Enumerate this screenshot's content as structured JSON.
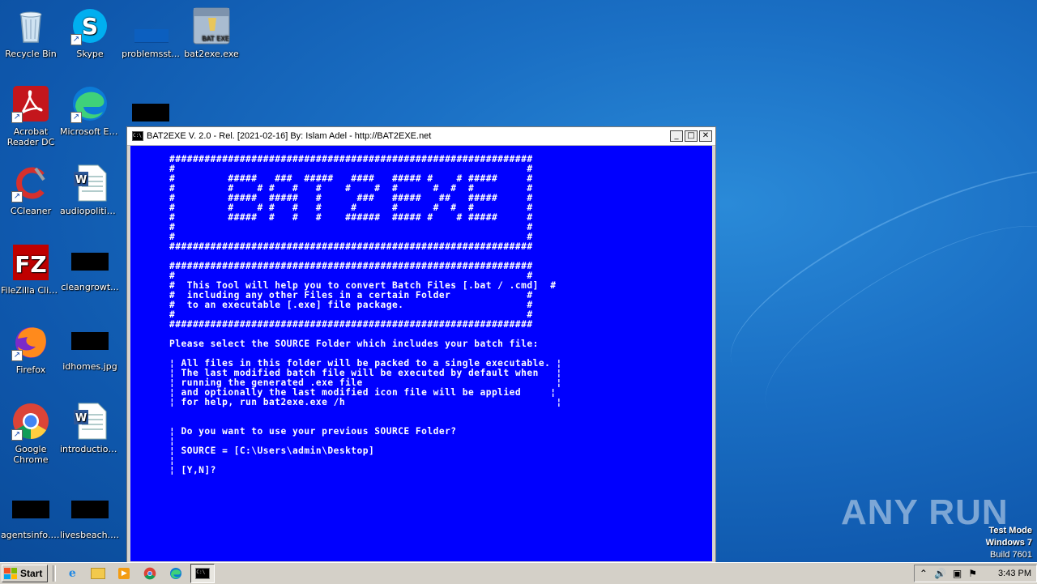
{
  "desktop": {
    "icons": [
      {
        "label": "Recycle Bin"
      },
      {
        "label": "Skype"
      },
      {
        "label": "problemsst..."
      },
      {
        "label": "bat2exe.exe"
      },
      {
        "label": "Acrobat Reader DC"
      },
      {
        "label": "Microsoft Edge"
      },
      {
        "label": "CCleaner"
      },
      {
        "label": "audiopolitic..."
      },
      {
        "label": "FileZilla Client"
      },
      {
        "label": "cleangrowt..."
      },
      {
        "label": "Firefox"
      },
      {
        "label": "idhomes.jpg"
      },
      {
        "label": "Google Chrome"
      },
      {
        "label": "introduction..."
      },
      {
        "label": "agentsinfo.jpg"
      },
      {
        "label": "livesbeach.jpg"
      }
    ]
  },
  "window": {
    "title": "BAT2EXE V. 2.0 - Rel. [2021-02-16] By: Islam Adel - http://BAT2EXE.net",
    "console_text": "##############################################################\n#                                                            #\n#         #####   ###  #####   ####   ##### #    # #####     #\n#         #    # #   #   #    #    #  #      #  #  #         #\n#         #####  #####   #      ###   #####   ##   #####     #\n#         #    # #   #   #     #      #      #  #  #         #\n#         #####  #   #   #    ######  ##### #    # #####     #\n#                                                            #\n#                                                            #\n##############################################################\n\n##############################################################\n#                                                            #\n#  This Tool will help you to convert Batch Files [.bat / .cmd]  #\n#  including any other Files in a certain Folder             #\n#  to an executable [.exe] file package.                     #\n#                                                            #\n##############################################################\n\nPlease select the SOURCE Folder which includes your batch file:\n\n¦ All files in this folder will be packed to a single executable. ¦\n¦ The last modified batch file will be executed by default when   ¦\n¦ running the generated .exe file                                 ¦\n¦ and optionally the last modified icon file will be applied     ¦\n¦ for help, run bat2exe.exe /h                                    ¦\n\n\n¦ Do you want to use your previous SOURCE Folder?\n¦\n¦ SOURCE = [C:\\Users\\admin\\Desktop]\n¦\n¦ [Y,N]?"
  },
  "watermark": {
    "text": "ANY RUN"
  },
  "system": {
    "test_mode": "Test Mode",
    "os": "Windows 7",
    "build": "Build 7601"
  },
  "taskbar": {
    "start_label": "Start",
    "clock": "3:43 PM"
  }
}
